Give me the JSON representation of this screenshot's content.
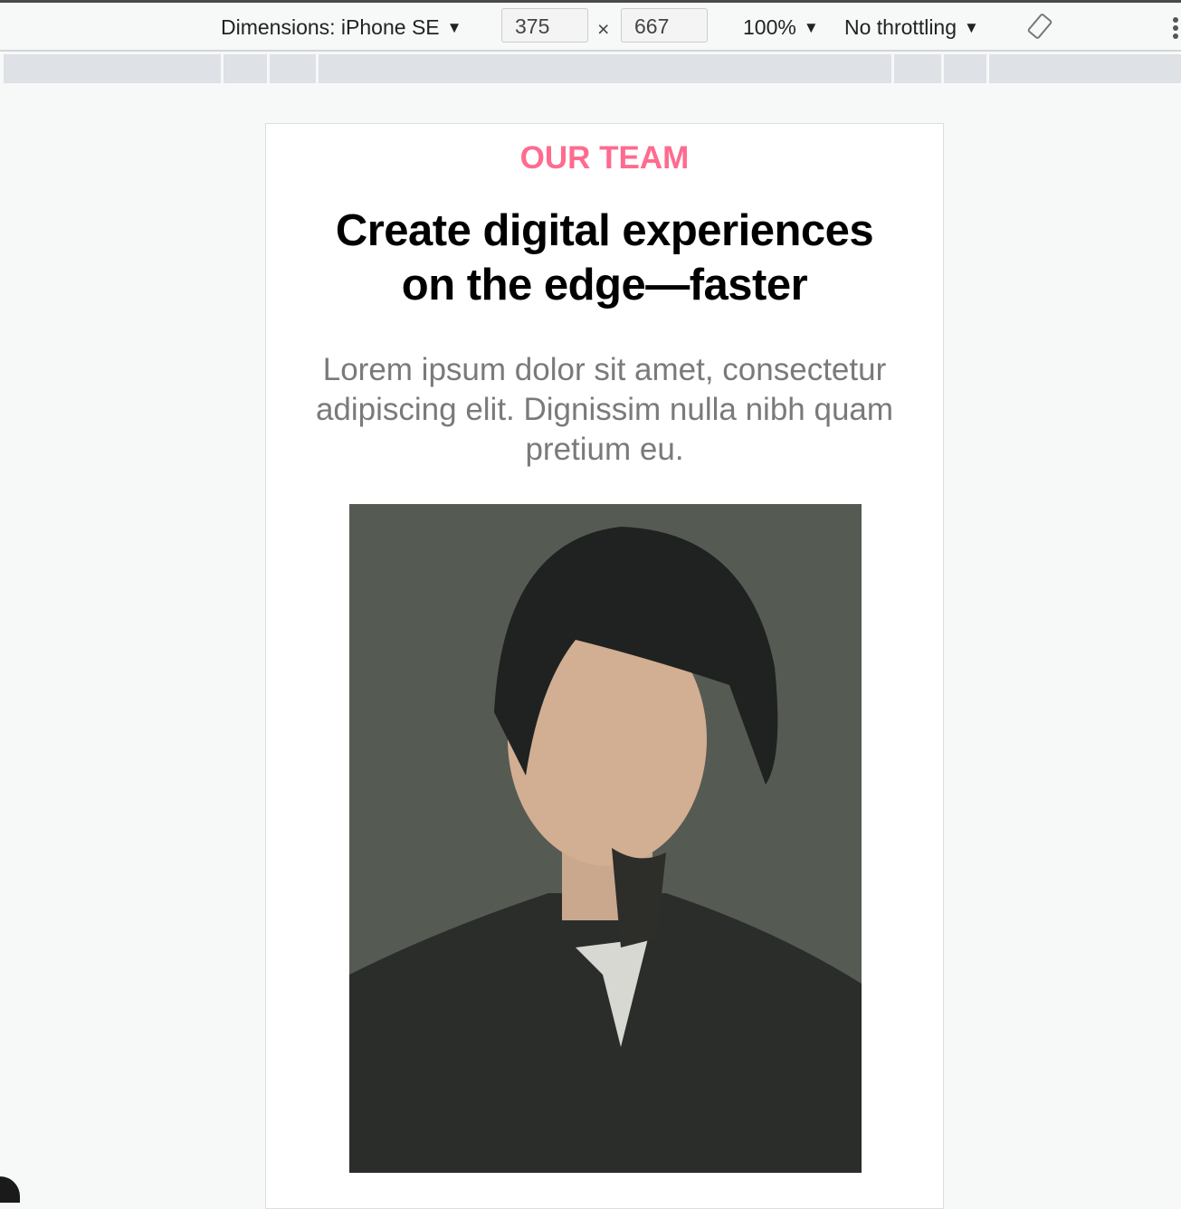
{
  "toolbar": {
    "dimensions_label": "Dimensions: iPhone SE",
    "width_value": "375",
    "times": "×",
    "height_value": "667",
    "zoom_label": "100%",
    "throttling_label": "No throttling",
    "rotate_icon": "rotate-icon",
    "more_icon": "kebab-icon"
  },
  "page": {
    "eyebrow": "OUR TEAM",
    "heading_line1": "Create digital experiences",
    "heading_line2": "on the edge—faster",
    "lead": "Lorem ipsum dolor sit amet, consectetur adipiscing elit. Dignissim nulla nibh quam pretium eu.",
    "photo_alt": "Team member portrait"
  },
  "colors": {
    "accent": "#ff6b8f",
    "lead_text": "#7a7a7a"
  }
}
